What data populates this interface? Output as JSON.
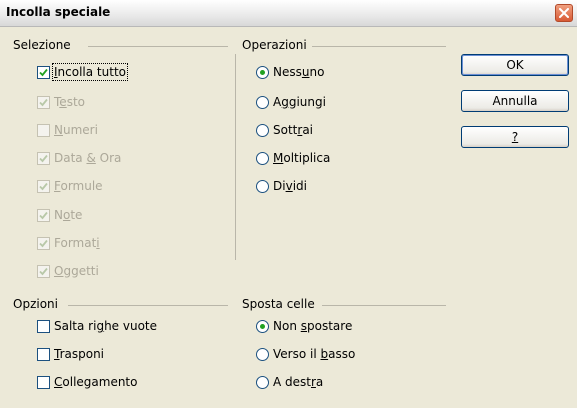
{
  "window": {
    "title": "Incolla speciale"
  },
  "selezione": {
    "label": "Selezione",
    "items": [
      {
        "pre": "",
        "u": "I",
        "post": "ncolla tutto",
        "checked": true,
        "enabled": true
      },
      {
        "pre": "T",
        "u": "e",
        "post": "sto",
        "checked": true,
        "enabled": false
      },
      {
        "pre": "",
        "u": "N",
        "post": "umeri",
        "checked": false,
        "enabled": false
      },
      {
        "pre": "Data ",
        "u": "&",
        "post": " Ora",
        "checked": true,
        "enabled": false
      },
      {
        "pre": "",
        "u": "F",
        "post": "ormule",
        "checked": true,
        "enabled": false
      },
      {
        "pre": "N",
        "u": "o",
        "post": "te",
        "checked": true,
        "enabled": false
      },
      {
        "pre": "Format",
        "u": "i",
        "post": "",
        "checked": true,
        "enabled": false
      },
      {
        "pre": "",
        "u": "O",
        "post": "ggetti",
        "checked": true,
        "enabled": false
      }
    ]
  },
  "operazioni": {
    "label": "Operazioni",
    "items": [
      {
        "pre": "Ness",
        "u": "u",
        "post": "no",
        "selected": true
      },
      {
        "pre": "A",
        "u": "g",
        "post": "giungi",
        "selected": false
      },
      {
        "pre": "Sott",
        "u": "r",
        "post": "ai",
        "selected": false
      },
      {
        "pre": "",
        "u": "M",
        "post": "oltiplica",
        "selected": false
      },
      {
        "pre": "Di",
        "u": "v",
        "post": "idi",
        "selected": false
      }
    ]
  },
  "opzioni": {
    "label": "Opzioni",
    "items": [
      {
        "pre": "Salta ri",
        "u": "g",
        "post": "he vuote",
        "checked": false
      },
      {
        "pre": "",
        "u": "T",
        "post": "rasponi",
        "checked": false
      },
      {
        "pre": "",
        "u": "C",
        "post": "ollegamento",
        "checked": false
      }
    ]
  },
  "sposta_celle": {
    "label": "Sposta celle",
    "items": [
      {
        "pre": "Non ",
        "u": "s",
        "post": "postare",
        "selected": true
      },
      {
        "pre": "Verso il ",
        "u": "b",
        "post": "asso",
        "selected": false
      },
      {
        "pre": "A dest",
        "u": "r",
        "post": "a",
        "selected": false
      }
    ]
  },
  "buttons": {
    "ok": "OK",
    "cancel": "Annulla",
    "help": "?"
  },
  "colors": {
    "dialog_bg": "#ece9d8",
    "check_mark": "#21a121",
    "disabled_text": "#aca899"
  },
  "icons": {
    "close": "close-x-icon",
    "check": "check-mark-icon"
  }
}
